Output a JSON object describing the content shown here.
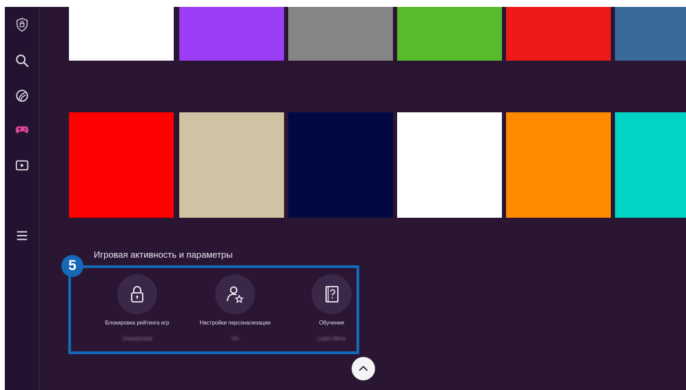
{
  "sidebar": {
    "items": [
      {
        "name": "privacy-shield-icon"
      },
      {
        "name": "search-icon"
      },
      {
        "name": "ambient-icon"
      },
      {
        "name": "gamepad-icon"
      },
      {
        "name": "media-icon"
      },
      {
        "name": "menu-icon"
      }
    ],
    "active_color": "#e0459a"
  },
  "tiles": {
    "row1": [
      "#ffffff",
      "#9b3df5",
      "#858585",
      "#58bb2c",
      "#ee1a1a",
      "#3a6a99"
    ],
    "row2": [
      "#ff0000",
      "#cfc3a3",
      "#010942",
      "#ffffff",
      "#ff8a00",
      "#00d4c4"
    ]
  },
  "section": {
    "title": "Игровая активность и параметры",
    "badge": "5",
    "highlight_color": "#1569b8",
    "settings": [
      {
        "icon": "lock-icon",
        "label": "Блокировка рейтинга игр",
        "value": "Unrestricted"
      },
      {
        "icon": "user-star-icon",
        "label": "Настройки персонализации",
        "value": "On"
      },
      {
        "icon": "help-book-icon",
        "label": "Обучение",
        "value": "Learn More"
      }
    ]
  }
}
